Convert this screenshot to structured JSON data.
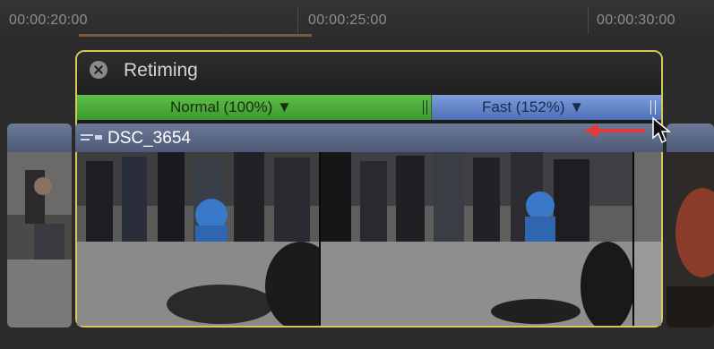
{
  "ruler": {
    "timecodes": [
      "00:00:20:00",
      "00:00:25:00",
      "00:00:30:00"
    ]
  },
  "retiming": {
    "title": "Retiming",
    "normal_label": "Normal (100%) ▼",
    "fast_label": "Fast (152%) ▼"
  },
  "clip": {
    "name": "DSC_3654"
  },
  "colors": {
    "selection_border": "#d6c95a",
    "normal_speed": "#3a9a2d",
    "fast_speed": "#4e70b6",
    "annotation_arrow": "#e23a3a"
  },
  "icons": [
    "close-icon",
    "clip-menu-icon",
    "mouse-pointer-icon",
    "red-arrow-icon"
  ]
}
